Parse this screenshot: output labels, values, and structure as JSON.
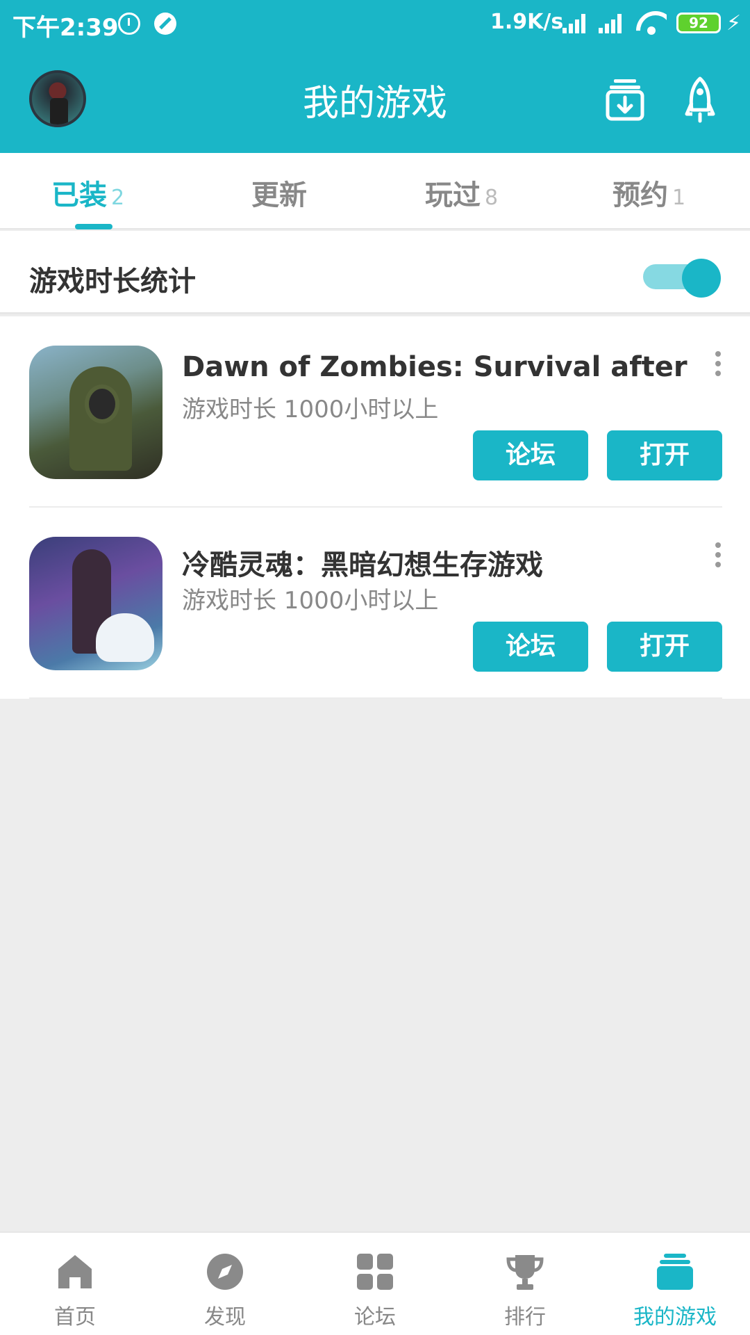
{
  "status_bar": {
    "time": "下午2:39",
    "network_speed": "1.9K/s",
    "battery": "92",
    "icons": [
      "alarm-icon",
      "do-not-disturb-icon",
      "signal-icon",
      "signal-icon",
      "wifi-icon",
      "battery-icon",
      "charging-icon"
    ]
  },
  "header": {
    "title": "我的游戏",
    "icons": [
      "avatar",
      "download-manager-icon",
      "rocket-icon"
    ]
  },
  "tabs": [
    {
      "label": "已装",
      "count": "2",
      "active": true
    },
    {
      "label": "更新",
      "count": "",
      "active": false
    },
    {
      "label": "玩过",
      "count": "8",
      "active": false
    },
    {
      "label": "预约",
      "count": "1",
      "active": false
    }
  ],
  "stats": {
    "label": "游戏时长统计",
    "toggle_on": true
  },
  "games": [
    {
      "title": "Dawn of Zombies: Survival after th...",
      "playtime": "游戏时长 1000小时以上",
      "forum_label": "论坛",
      "open_label": "打开",
      "icon": "game-icon-zombie"
    },
    {
      "title": "冷酷灵魂：黑暗幻想生存游戏",
      "playtime": "游戏时长 1000小时以上",
      "forum_label": "论坛",
      "open_label": "打开",
      "icon": "game-icon-soul"
    }
  ],
  "bottom_nav": [
    {
      "label": "首页",
      "icon": "home-icon",
      "active": false
    },
    {
      "label": "发现",
      "icon": "compass-icon",
      "active": false
    },
    {
      "label": "论坛",
      "icon": "grid-icon",
      "active": false
    },
    {
      "label": "排行",
      "icon": "trophy-icon",
      "active": false
    },
    {
      "label": "我的游戏",
      "icon": "my-games-icon",
      "active": true
    }
  ],
  "colors": {
    "accent": "#1ab6c7",
    "accent_light": "#86d9e2",
    "background": "#ededed",
    "inactive_text": "#888888"
  }
}
